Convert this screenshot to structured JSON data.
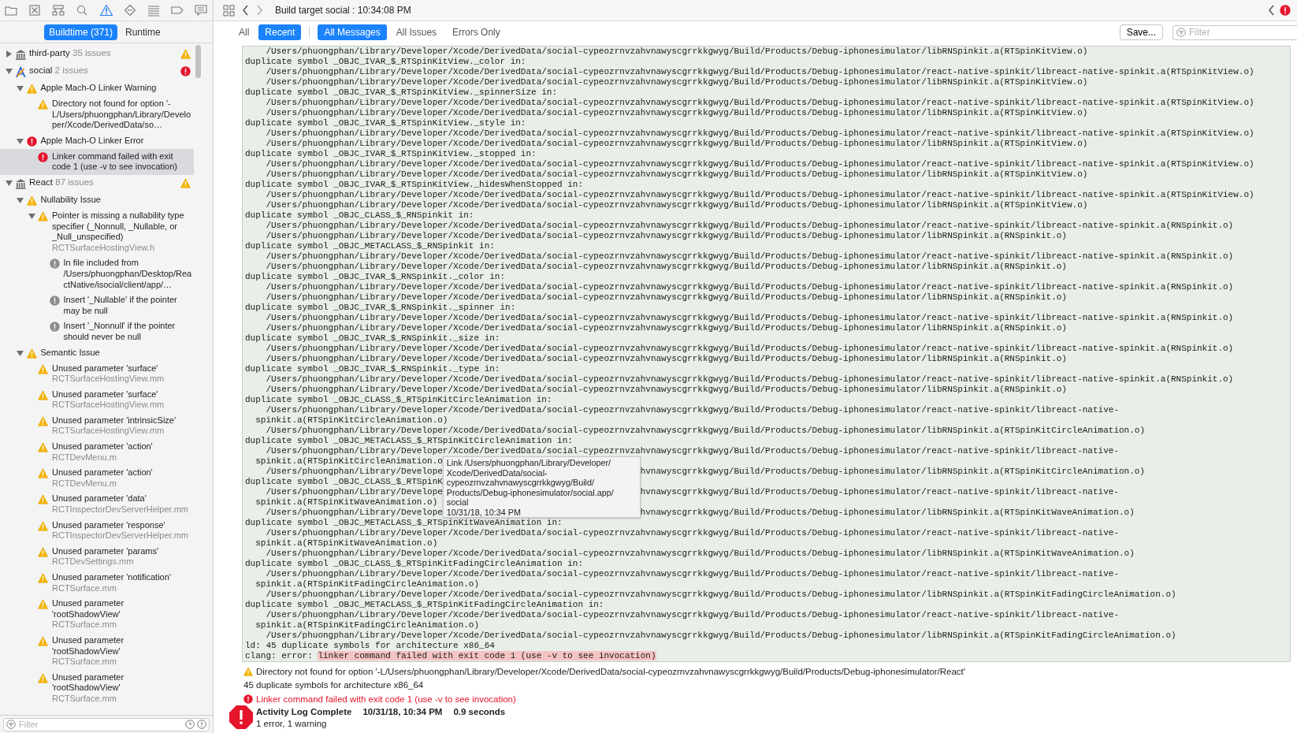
{
  "navigator_tabs": [
    {
      "selected": false
    },
    {
      "selected": false
    },
    {
      "selected": false
    },
    {
      "selected": false
    },
    {
      "selected": true
    },
    {
      "selected": false
    },
    {
      "selected": false
    },
    {
      "selected": false
    },
    {
      "selected": false
    }
  ],
  "issue_scope": [
    {
      "label": "Buildtime (371)",
      "selected": true
    },
    {
      "label": "Runtime",
      "selected": false
    }
  ],
  "issue_tree": [
    {
      "kind": "framework",
      "name": "third-party",
      "count": "35 issues",
      "error": false,
      "expanded": false,
      "selected": false
    },
    {
      "kind": "app",
      "name": "social",
      "count": "2 issues",
      "error": true,
      "expanded": true,
      "selected": false,
      "children": [
        {
          "kind": "category",
          "name": "Apple Mach-O Linker Warning",
          "error": false,
          "expanded": true,
          "selected": false,
          "children": [
            {
              "kind": "issue",
              "name": "Directory not found for option '-L/Users/phuongphan/Library/Developer/Xcode/DerivedData/so…",
              "error": false,
              "selected": false
            }
          ]
        },
        {
          "kind": "category",
          "name": "Apple Mach-O Linker Error",
          "error": true,
          "expanded": true,
          "selected": false,
          "children": [
            {
              "kind": "issue",
              "name": "Linker command failed with exit code 1 (use -v to see invocation)",
              "error": true,
              "selected": true
            }
          ]
        }
      ]
    },
    {
      "kind": "framework",
      "name": "React",
      "count": "87 issues",
      "error": false,
      "expanded": true,
      "selected": false,
      "children": [
        {
          "kind": "category",
          "name": "Nullability Issue",
          "error": false,
          "expanded": true,
          "selected": false,
          "children": [
            {
              "kind": "issue",
              "name": "Pointer is missing a nullability type specifier (_Nonnull, _Nullable, or _Null_unspecified)",
              "file": "RCTSurfaceHostingView.h",
              "error": false,
              "expanded": true,
              "selected": false,
              "children": [
                {
                  "kind": "note",
                  "name": "In file included from /Users/phuongphan/Desktop/ReactNative/isocial/client/app/…",
                  "selected": false
                },
                {
                  "kind": "note",
                  "name": "Insert '_Nullable' if the pointer may be null",
                  "selected": false
                },
                {
                  "kind": "note",
                  "name": "Insert '_Nonnull' if the pointer should never be null",
                  "selected": false
                }
              ]
            }
          ]
        },
        {
          "kind": "category",
          "name": "Semantic Issue",
          "error": false,
          "expanded": true,
          "selected": false,
          "children": [
            {
              "kind": "issue",
              "name": "Unused parameter 'surface'",
              "file": "RCTSurfaceHostingView.mm",
              "error": false,
              "selected": false
            },
            {
              "kind": "issue",
              "name": "Unused parameter 'surface'",
              "file": "RCTSurfaceHostingView.mm",
              "error": false,
              "selected": false
            },
            {
              "kind": "issue",
              "name": "Unused parameter 'intrinsicSize'",
              "file": "RCTSurfaceHostingView.mm",
              "error": false,
              "selected": false
            },
            {
              "kind": "issue",
              "name": "Unused parameter 'action'",
              "file": "RCTDevMenu.m",
              "error": false,
              "selected": false
            },
            {
              "kind": "issue",
              "name": "Unused parameter 'action'",
              "file": "RCTDevMenu.m",
              "error": false,
              "selected": false
            },
            {
              "kind": "issue",
              "name": "Unused parameter 'data'",
              "file": "RCTInspectorDevServerHelper.mm",
              "error": false,
              "selected": false
            },
            {
              "kind": "issue",
              "name": "Unused parameter 'response'",
              "file": "RCTInspectorDevServerHelper.mm",
              "error": false,
              "selected": false
            },
            {
              "kind": "issue",
              "name": "Unused parameter 'params'",
              "file": "RCTDevSettings.mm",
              "error": false,
              "selected": false
            },
            {
              "kind": "issue",
              "name": "Unused parameter 'notification'",
              "file": "RCTSurface.mm",
              "error": false,
              "selected": false
            },
            {
              "kind": "issue",
              "name": "Unused parameter 'rootShadowView'",
              "file": "RCTSurface.mm",
              "error": false,
              "selected": false
            },
            {
              "kind": "issue",
              "name": "Unused parameter 'rootShadowView'",
              "file": "RCTSurface.mm",
              "error": false,
              "selected": false
            },
            {
              "kind": "issue",
              "name": "Unused parameter 'rootShadowView'",
              "file": "RCTSurface.mm",
              "error": false,
              "selected": false
            }
          ]
        }
      ]
    }
  ],
  "sidebar_filter": {
    "placeholder": "Filter"
  },
  "build_title": "Build target social : 10:34:08 PM",
  "scope_filters": [
    {
      "label": "All",
      "selected": false
    },
    {
      "label": "Recent",
      "selected": true
    }
  ],
  "message_filters": [
    {
      "label": "All Messages",
      "selected": true
    },
    {
      "label": "All Issues",
      "selected": false
    },
    {
      "label": "Errors Only",
      "selected": false
    }
  ],
  "save_button": "Save...",
  "filter_field": {
    "placeholder": "Filter"
  },
  "log_lines": [
    {
      "text": "    /Users/phuongphan/Library/Developer/Xcode/DerivedData/social-cypeozrnvzahvnawyscgrrkkgwyg/Build/Products/Debug-iphonesimulator/libRNSpinkit.a(RTSpinKitView.o)"
    },
    {
      "text": "duplicate symbol _OBJC_IVAR_$_RTSpinKitView._color in:"
    },
    {
      "text": "    /Users/phuongphan/Library/Developer/Xcode/DerivedData/social-cypeozrnvzahvnawyscgrrkkgwyg/Build/Products/Debug-iphonesimulator/react-native-spinkit/libreact-native-spinkit.a(RTSpinKitView.o)"
    },
    {
      "text": "    /Users/phuongphan/Library/Developer/Xcode/DerivedData/social-cypeozrnvzahvnawyscgrrkkgwyg/Build/Products/Debug-iphonesimulator/libRNSpinkit.a(RTSpinKitView.o)"
    },
    {
      "text": "duplicate symbol _OBJC_IVAR_$_RTSpinKitView._spinnerSize in:"
    },
    {
      "text": "    /Users/phuongphan/Library/Developer/Xcode/DerivedData/social-cypeozrnvzahvnawyscgrrkkgwyg/Build/Products/Debug-iphonesimulator/react-native-spinkit/libreact-native-spinkit.a(RTSpinKitView.o)"
    },
    {
      "text": "    /Users/phuongphan/Library/Developer/Xcode/DerivedData/social-cypeozrnvzahvnawyscgrrkkgwyg/Build/Products/Debug-iphonesimulator/libRNSpinkit.a(RTSpinKitView.o)"
    },
    {
      "text": "duplicate symbol _OBJC_IVAR_$_RTSpinKitView._style in:"
    },
    {
      "text": "    /Users/phuongphan/Library/Developer/Xcode/DerivedData/social-cypeozrnvzahvnawyscgrrkkgwyg/Build/Products/Debug-iphonesimulator/react-native-spinkit/libreact-native-spinkit.a(RTSpinKitView.o)"
    },
    {
      "text": "    /Users/phuongphan/Library/Developer/Xcode/DerivedData/social-cypeozrnvzahvnawyscgrrkkgwyg/Build/Products/Debug-iphonesimulator/libRNSpinkit.a(RTSpinKitView.o)"
    },
    {
      "text": "duplicate symbol _OBJC_IVAR_$_RTSpinKitView._stopped in:"
    },
    {
      "text": "    /Users/phuongphan/Library/Developer/Xcode/DerivedData/social-cypeozrnvzahvnawyscgrrkkgwyg/Build/Products/Debug-iphonesimulator/react-native-spinkit/libreact-native-spinkit.a(RTSpinKitView.o)"
    },
    {
      "text": "    /Users/phuongphan/Library/Developer/Xcode/DerivedData/social-cypeozrnvzahvnawyscgrrkkgwyg/Build/Products/Debug-iphonesimulator/libRNSpinkit.a(RTSpinKitView.o)"
    },
    {
      "text": "duplicate symbol _OBJC_IVAR_$_RTSpinKitView._hidesWhenStopped in:"
    },
    {
      "text": "    /Users/phuongphan/Library/Developer/Xcode/DerivedData/social-cypeozrnvzahvnawyscgrrkkgwyg/Build/Products/Debug-iphonesimulator/react-native-spinkit/libreact-native-spinkit.a(RTSpinKitView.o)"
    },
    {
      "text": "    /Users/phuongphan/Library/Developer/Xcode/DerivedData/social-cypeozrnvzahvnawyscgrrkkgwyg/Build/Products/Debug-iphonesimulator/libRNSpinkit.a(RTSpinKitView.o)"
    },
    {
      "text": "duplicate symbol _OBJC_CLASS_$_RNSpinkit in:"
    },
    {
      "text": "    /Users/phuongphan/Library/Developer/Xcode/DerivedData/social-cypeozrnvzahvnawyscgrrkkgwyg/Build/Products/Debug-iphonesimulator/react-native-spinkit/libreact-native-spinkit.a(RNSpinkit.o)"
    },
    {
      "text": "    /Users/phuongphan/Library/Developer/Xcode/DerivedData/social-cypeozrnvzahvnawyscgrrkkgwyg/Build/Products/Debug-iphonesimulator/libRNSpinkit.a(RNSpinkit.o)"
    },
    {
      "text": "duplicate symbol _OBJC_METACLASS_$_RNSpinkit in:"
    },
    {
      "text": "    /Users/phuongphan/Library/Developer/Xcode/DerivedData/social-cypeozrnvzahvnawyscgrrkkgwyg/Build/Products/Debug-iphonesimulator/react-native-spinkit/libreact-native-spinkit.a(RNSpinkit.o)"
    },
    {
      "text": "    /Users/phuongphan/Library/Developer/Xcode/DerivedData/social-cypeozrnvzahvnawyscgrrkkgwyg/Build/Products/Debug-iphonesimulator/libRNSpinkit.a(RNSpinkit.o)"
    },
    {
      "text": "duplicate symbol _OBJC_IVAR_$_RNSpinkit._color in:"
    },
    {
      "text": "    /Users/phuongphan/Library/Developer/Xcode/DerivedData/social-cypeozrnvzahvnawyscgrrkkgwyg/Build/Products/Debug-iphonesimulator/react-native-spinkit/libreact-native-spinkit.a(RNSpinkit.o)"
    },
    {
      "text": "    /Users/phuongphan/Library/Developer/Xcode/DerivedData/social-cypeozrnvzahvnawyscgrrkkgwyg/Build/Products/Debug-iphonesimulator/libRNSpinkit.a(RNSpinkit.o)"
    },
    {
      "text": "duplicate symbol _OBJC_IVAR_$_RNSpinkit._spinner in:"
    },
    {
      "text": "    /Users/phuongphan/Library/Developer/Xcode/DerivedData/social-cypeozrnvzahvnawyscgrrkkgwyg/Build/Products/Debug-iphonesimulator/react-native-spinkit/libreact-native-spinkit.a(RNSpinkit.o)"
    },
    {
      "text": "    /Users/phuongphan/Library/Developer/Xcode/DerivedData/social-cypeozrnvzahvnawyscgrrkkgwyg/Build/Products/Debug-iphonesimulator/libRNSpinkit.a(RNSpinkit.o)"
    },
    {
      "text": "duplicate symbol _OBJC_IVAR_$_RNSpinkit._size in:"
    },
    {
      "text": "    /Users/phuongphan/Library/Developer/Xcode/DerivedData/social-cypeozrnvzahvnawyscgrrkkgwyg/Build/Products/Debug-iphonesimulator/react-native-spinkit/libreact-native-spinkit.a(RNSpinkit.o)"
    },
    {
      "text": "    /Users/phuongphan/Library/Developer/Xcode/DerivedData/social-cypeozrnvzahvnawyscgrrkkgwyg/Build/Products/Debug-iphonesimulator/libRNSpinkit.a(RNSpinkit.o)"
    },
    {
      "text": "duplicate symbol _OBJC_IVAR_$_RNSpinkit._type in:"
    },
    {
      "text": "    /Users/phuongphan/Library/Developer/Xcode/DerivedData/social-cypeozrnvzahvnawyscgrrkkgwyg/Build/Products/Debug-iphonesimulator/react-native-spinkit/libreact-native-spinkit.a(RNSpinkit.o)"
    },
    {
      "text": "    /Users/phuongphan/Library/Developer/Xcode/DerivedData/social-cypeozrnvzahvnawyscgrrkkgwyg/Build/Products/Debug-iphonesimulator/libRNSpinkit.a(RNSpinkit.o)"
    },
    {
      "text": "duplicate symbol _OBJC_CLASS_$_RTSpinKitCircleAnimation in:"
    },
    {
      "text": "    /Users/phuongphan/Library/Developer/Xcode/DerivedData/social-cypeozrnvzahvnawyscgrrkkgwyg/Build/Products/Debug-iphonesimulator/react-native-spinkit/libreact-native-"
    },
    {
      "text": "  spinkit.a(RTSpinKitCircleAnimation.o)"
    },
    {
      "text": "    /Users/phuongphan/Library/Developer/Xcode/DerivedData/social-cypeozrnvzahvnawyscgrrkkgwyg/Build/Products/Debug-iphonesimulator/libRNSpinkit.a(RTSpinKitCircleAnimation.o)"
    },
    {
      "text": "duplicate symbol _OBJC_METACLASS_$_RTSpinKitCircleAnimation in:"
    },
    {
      "text": "    /Users/phuongphan/Library/Developer/Xcode/DerivedData/social-cypeozrnvzahvnawyscgrrkkgwyg/Build/Products/Debug-iphonesimulator/react-native-spinkit/libreact-native-"
    },
    {
      "text": "  spinkit.a(RTSpinKitCircleAnimation.o"
    },
    {
      "text": "    /Users/phuongphan/Library/Develope",
      "after": "hvnawyscgrrkkgwyg/Build/Products/Debug-iphonesimulator/libRNSpinkit.a(RTSpinKitCircleAnimation.o)"
    },
    {
      "text": "duplicate symbol _OBJC_CLASS_$_RTSpinK"
    },
    {
      "text": "    /Users/phuongphan/Library/Develope",
      "after": "hvnawyscgrrkkgwyg/Build/Products/Debug-iphonesimulator/react-native-spinkit/libreact-native-"
    },
    {
      "text": "  spinkit.a(RTSpinKitWaveAnimation.o)"
    },
    {
      "text": "    /Users/phuongphan/Library/Develope",
      "after": "hvnawyscgrrkkgwyg/Build/Products/Debug-iphonesimulator/libRNSpinkit.a(RTSpinKitWaveAnimation.o)"
    },
    {
      "text": "duplicate symbol _OBJC_METACLASS_$_RTSpinKitWaveAnimation in:"
    },
    {
      "text": "    /Users/phuongphan/Library/Developer/Xcode/DerivedData/social-cypeozrnvzahvnawyscgrrkkgwyg/Build/Products/Debug-iphonesimulator/react-native-spinkit/libreact-native-"
    },
    {
      "text": "  spinkit.a(RTSpinKitWaveAnimation.o)"
    },
    {
      "text": "    /Users/phuongphan/Library/Developer/Xcode/DerivedData/social-cypeozrnvzahvnawyscgrrkkgwyg/Build/Products/Debug-iphonesimulator/libRNSpinkit.a(RTSpinKitWaveAnimation.o)"
    },
    {
      "text": "duplicate symbol _OBJC_CLASS_$_RTSpinKitFadingCircleAnimation in:"
    },
    {
      "text": "    /Users/phuongphan/Library/Developer/Xcode/DerivedData/social-cypeozrnvzahvnawyscgrrkkgwyg/Build/Products/Debug-iphonesimulator/react-native-spinkit/libreact-native-"
    },
    {
      "text": "  spinkit.a(RTSpinKitFadingCircleAnimation.o)"
    },
    {
      "text": "    /Users/phuongphan/Library/Developer/Xcode/DerivedData/social-cypeozrnvzahvnawyscgrrkkgwyg/Build/Products/Debug-iphonesimulator/libRNSpinkit.a(RTSpinKitFadingCircleAnimation.o)"
    },
    {
      "text": "duplicate symbol _OBJC_METACLASS_$_RTSpinKitFadingCircleAnimation in:"
    },
    {
      "text": "    /Users/phuongphan/Library/Developer/Xcode/DerivedData/social-cypeozrnvzahvnawyscgrrkkgwyg/Build/Products/Debug-iphonesimulator/react-native-spinkit/libreact-native-"
    },
    {
      "text": "  spinkit.a(RTSpinKitFadingCircleAnimation.o)"
    },
    {
      "text": "    /Users/phuongphan/Library/Developer/Xcode/DerivedData/social-cypeozrnvzahvnawyscgrrkkgwyg/Build/Products/Debug-iphonesimulator/libRNSpinkit.a(RTSpinKitFadingCircleAnimation.o)"
    },
    {
      "text": "ld: 45 duplicate symbols for architecture x86_64"
    },
    {
      "text": "clang: error: ",
      "highlight": "linker command failed with exit code 1 (use -v to see invocation)"
    }
  ],
  "tooltip": {
    "lines": [
      "Link /Users/phuongphan/Library/Developer/",
      "Xcode/DerivedData/social-",
      "cypeozrnvzahvnawyscgrrkkgwyg/Build/",
      "Products/Debug-iphonesimulator/social.app/",
      "social",
      "10/31/18, 10:34 PM"
    ]
  },
  "summary": [
    {
      "kind": "warning",
      "text": "Directory not found for option '-L/Users/phuongphan/Library/Developer/Xcode/DerivedData/social-cypeozrnvzahvnawyscgrrkkgwyg/Build/Products/Debug-iphonesimulator/React'"
    },
    {
      "kind": "plain",
      "text": "45 duplicate symbols for architecture x86_64"
    },
    {
      "kind": "error",
      "text": "Linker command failed with exit code 1 (use -v to see invocation)"
    }
  ],
  "activity": {
    "error": true,
    "title": "Activity Log Complete",
    "time": "10/31/18, 10:34 PM",
    "duration": "0.9 seconds",
    "result": "1 error, 1 warning"
  }
}
